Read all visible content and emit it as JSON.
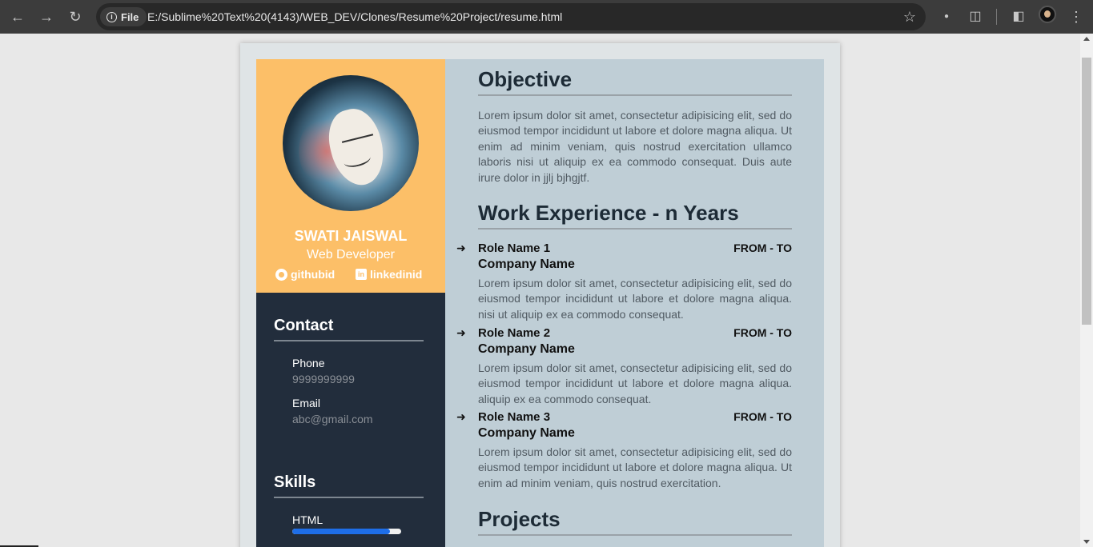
{
  "browser": {
    "site_label": "File",
    "url": "E:/Sublime%20Text%20(4143)/WEB_DEV/Clones/Resume%20Project/resume.html"
  },
  "profile": {
    "name": "SWATI JAISWAL",
    "title": "Web Developer",
    "github": "githubid",
    "linkedin": "linkedinid"
  },
  "contact": {
    "heading": "Contact",
    "phone_label": "Phone",
    "phone_value": "9999999999",
    "email_label": "Email",
    "email_value": "abc@gmail.com"
  },
  "skills": {
    "heading": "Skills",
    "items": [
      {
        "label": "HTML",
        "level": 0.9
      }
    ]
  },
  "objective": {
    "heading": "Objective",
    "text": "Lorem ipsum dolor sit amet, consectetur adipisicing elit, sed do eiusmod tempor incididunt ut labore et dolore magna aliqua. Ut enim ad minim veniam, quis nostrud exercitation ullamco laboris nisi ut aliquip ex ea commodo consequat. Duis aute irure dolor in jjlj bjhgjtf."
  },
  "experience": {
    "heading": "Work Experience - n Years",
    "jobs": [
      {
        "role": "Role Name 1",
        "dates": "FROM - TO",
        "company": "Company Name",
        "text": "Lorem ipsum dolor sit amet, consectetur adipisicing elit, sed do eiusmod tempor incididunt ut labore et dolore magna aliqua. nisi ut aliquip ex ea commodo consequat."
      },
      {
        "role": "Role Name 2",
        "dates": "FROM - TO",
        "company": "Company Name",
        "text": "Lorem ipsum dolor sit amet, consectetur adipisicing elit, sed do eiusmod tempor incididunt ut labore et dolore magna aliqua. aliquip ex ea commodo consequat."
      },
      {
        "role": "Role Name 3",
        "dates": "FROM - TO",
        "company": "Company Name",
        "text": "Lorem ipsum dolor sit amet, consectetur adipisicing elit, sed do eiusmod tempor incididunt ut labore et dolore magna aliqua. Ut enim ad minim veniam, quis nostrud exercitation."
      }
    ]
  },
  "projects": {
    "heading": "Projects"
  },
  "icons": {
    "back": "arrow-left-icon",
    "forward": "arrow-right-icon",
    "reload": "reload-icon",
    "info": "info-icon",
    "bookmark": "star-icon",
    "extensions": "puzzle-icon",
    "sidepanel": "side-panel-icon",
    "menu": "kebab-menu-icon",
    "job": "sign-out-icon"
  },
  "colors": {
    "profile_bg": "#fcbf68",
    "sidebar_bg": "#222d3c",
    "main_bg": "#bfced6",
    "skill_fill": "#1e6ee8"
  }
}
